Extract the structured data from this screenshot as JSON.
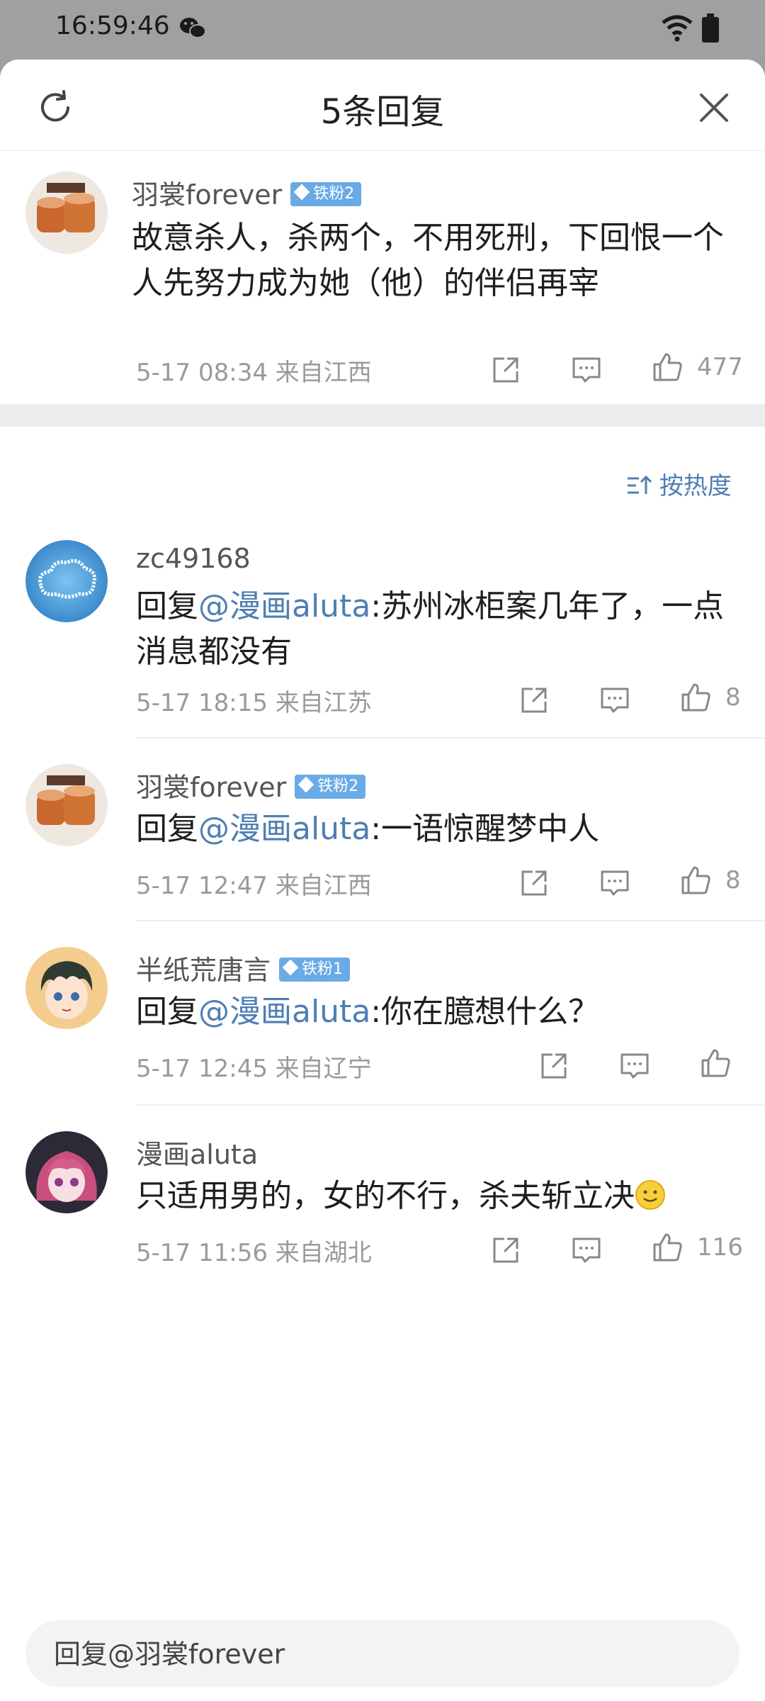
{
  "status": {
    "time": "16:59:46"
  },
  "header": {
    "title": "5条回复"
  },
  "main_comment": {
    "user": "羽裳forever",
    "badge": "铁粉2",
    "text": "故意杀人，杀两个，不用死刑，下回恨一个人先努力成为她（他）的伴侣再宰",
    "meta": "5-17 08:34  来自江西",
    "likes": "477"
  },
  "sort_label": "按热度",
  "replies": [
    {
      "user": "zc49168",
      "badge": "",
      "prefix": "回复",
      "mention": "@漫画aluta",
      "text": ":苏州冰柜案几年了，一点消息都没有",
      "meta": "5-17 18:15  来自江苏",
      "likes": "8"
    },
    {
      "user": "羽裳forever",
      "badge": "铁粉2",
      "prefix": "回复",
      "mention": "@漫画aluta",
      "text": ":一语惊醒梦中人",
      "meta": "5-17 12:47  来自江西",
      "likes": "8"
    },
    {
      "user": "半纸荒唐言",
      "badge": "铁粉1",
      "prefix": "回复",
      "mention": "@漫画aluta",
      "text": ":你在臆想什么？",
      "meta": "5-17 12:45  来自辽宁",
      "likes": ""
    },
    {
      "user": "漫画aluta",
      "badge": "",
      "prefix": "",
      "mention": "",
      "text": "只适用男的，女的不行，杀夫斩立决",
      "meta": "5-17 11:56  来自湖北",
      "likes": "116"
    }
  ],
  "reply_box": {
    "placeholder": "回复@羽裳forever"
  },
  "colors": {
    "accent": "#4e7fb3",
    "badge": "#6aaae6"
  }
}
